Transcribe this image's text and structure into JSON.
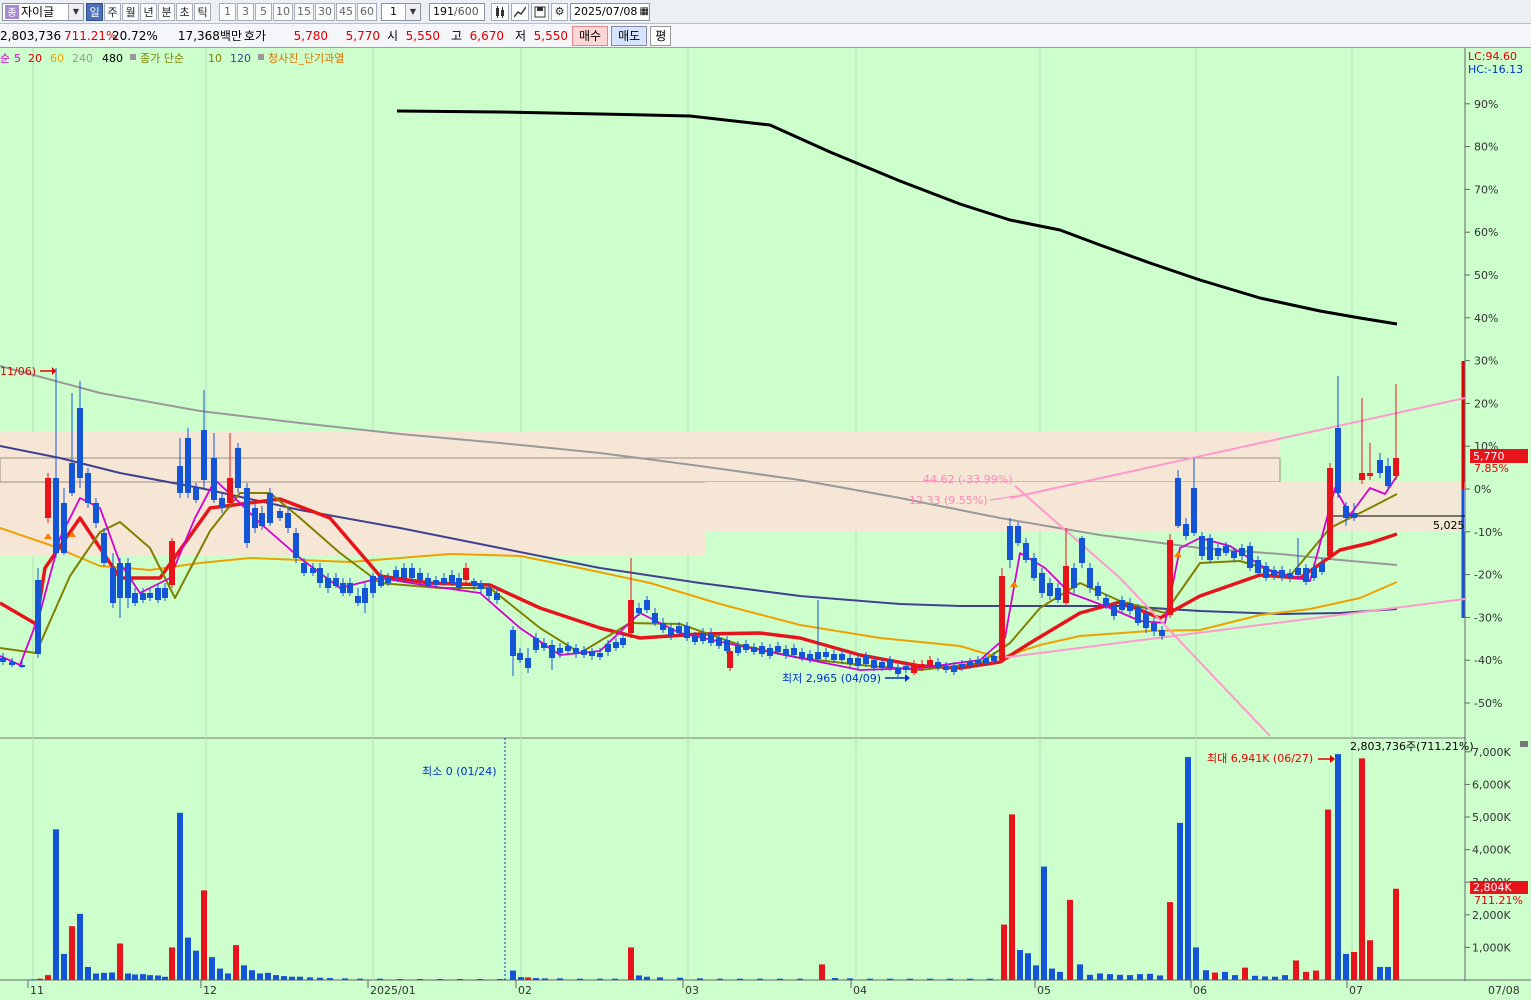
{
  "toolbar": {
    "stock_tag": "종",
    "stock_name": "자이글",
    "period_buttons": [
      "일",
      "주",
      "월",
      "년",
      "분",
      "초",
      "틱"
    ],
    "interval_buttons": [
      "1",
      "3",
      "5",
      "10",
      "15",
      "30",
      "45",
      "60"
    ],
    "interval_value": "1",
    "count_value": "191",
    "count_total": "/600",
    "date_value": "2025/07/08"
  },
  "quote": {
    "volume": "2,803,736",
    "volume_rate": "711.21%",
    "change_rate": "20.72%",
    "amount": "17,368백만",
    "hoga_label": "호가",
    "ask": "5,780",
    "bid": "5,770",
    "open_label": "시",
    "open": "5,550",
    "high_label": "고",
    "high": "6,670",
    "low_label": "저",
    "low": "5,550",
    "buy_label": "매수",
    "sell_label": "매도",
    "flat_label": "평"
  },
  "legend": {
    "prefix": "순",
    "ma": [
      {
        "label": "5",
        "color": "#d400d4"
      },
      {
        "label": "20",
        "color": "#e00000"
      },
      {
        "label": "60",
        "color": "#f0a000"
      },
      {
        "label": "240",
        "color": "#999999"
      },
      {
        "label": "480",
        "color": "#000000"
      }
    ],
    "ma2_label": "종가 단순",
    "ma2": [
      {
        "label": "10",
        "color": "#808000"
      },
      {
        "label": "120",
        "color": "#404090"
      }
    ],
    "signal": "청사진_단기과열"
  },
  "price_axis": {
    "lc": "LC:94.60",
    "hc": "HC:-16.13",
    "ticks": [
      "90%",
      "80%",
      "70%",
      "60%",
      "50%",
      "40%",
      "30%",
      "20%",
      "10%",
      "0%",
      "-10%",
      "-20%",
      "-30%",
      "-40%",
      "-50%"
    ],
    "current_price": "5,770",
    "current_change": "7.85%",
    "ref_price": "5,025"
  },
  "annotations": {
    "left_arrow": "11/06)",
    "low_marker": "최저 2,965 (04/09)",
    "box_text_1": "44.62 (-33.99%)",
    "box_text_2": "12.33 (9.55%)"
  },
  "volume_axis": {
    "header": "2,803,736주(711.21%)",
    "ticks": [
      "7,000K",
      "6,000K",
      "5,000K",
      "4,000K",
      "3,000K",
      "2,000K",
      "1,000K"
    ],
    "current": "2,804K",
    "current_rate": "711.21%",
    "min_marker": "최소 0 (01/24)",
    "max_marker": "최대 6,941K (06/27)"
  },
  "x_axis": {
    "labels": [
      "11",
      "12",
      "2025/01",
      "02",
      "03",
      "04",
      "05",
      "06",
      "07"
    ],
    "right_label": "07/08"
  },
  "colors": {
    "background": "#ccffcc",
    "up": "#e8141c",
    "down": "#1455d8",
    "zone": "#f6e6d6"
  }
}
